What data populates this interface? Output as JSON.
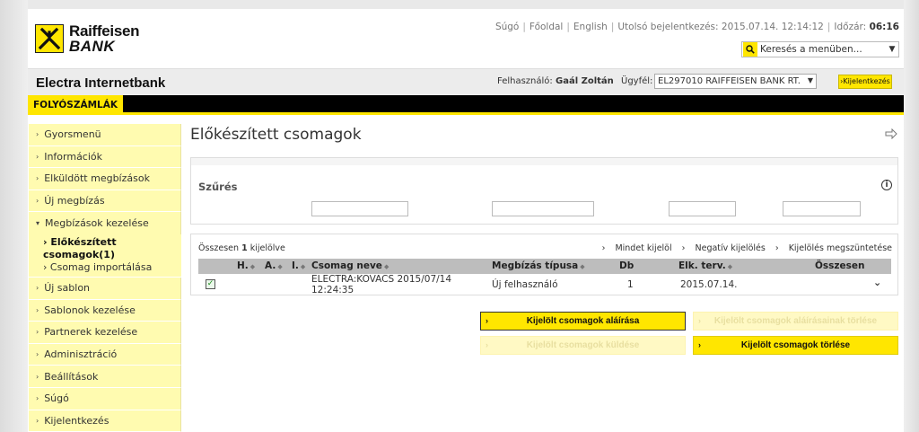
{
  "brand": {
    "line1": "Raiffeisen",
    "line2": "BANK"
  },
  "toplinks": {
    "help": "Súgó",
    "home": "Főoldal",
    "language": "English",
    "last_login_label": "Utolsó bejelentkezés:",
    "last_login_value": "2015.07.14. 12:14:12",
    "timer_label": "Időzár:",
    "timer_value": "06:16"
  },
  "menu_search": {
    "placeholder": "Keresés a menüben..."
  },
  "app": {
    "title": "Electra Internetbank",
    "user_label": "Felhasználó:",
    "user_name": "Gaál Zoltán",
    "client_label": "Ügyfél:",
    "client_value": "EL297010 RAIFFEISEN BANK RT.",
    "logout": "Kijelentkezés"
  },
  "nav": {
    "active_tab": "FOLYÓSZÁMLÁK"
  },
  "sidebar": {
    "items": [
      {
        "label": "Gyorsmenü"
      },
      {
        "label": "Információk"
      },
      {
        "label": "Elküldött megbízások"
      },
      {
        "label": "Új megbízás"
      },
      {
        "label": "Megbízások kezelése"
      }
    ],
    "subitems": [
      {
        "label": "Előkészített csomagok(1)"
      },
      {
        "label": "Csomag importálása"
      }
    ],
    "items2": [
      {
        "label": "Új sablon"
      },
      {
        "label": "Sablonok kezelése"
      },
      {
        "label": "Partnerek kezelése"
      },
      {
        "label": "Adminisztráció"
      },
      {
        "label": "Beállítások"
      },
      {
        "label": "Súgó"
      },
      {
        "label": "Kijelentkezés"
      }
    ]
  },
  "page": {
    "title": "Előkészített csomagok"
  },
  "filter": {
    "label": "Szűrés"
  },
  "results": {
    "count_prefix": "Összesen",
    "count_value": "1",
    "count_suffix": "kijelölve",
    "select_all": "Mindet kijelöl",
    "invert": "Negatív kijelölés",
    "clear": "Kijelölés megszüntetése",
    "columns": [
      "H.",
      "A.",
      "I.",
      "Csomag neve",
      "Megbízás típusa",
      "Db",
      "Elk. terv.",
      "Összesen"
    ],
    "rows": [
      {
        "name_line1": "ELECTRA:KOVACS 2015/07/14",
        "name_line2": "12:24:35",
        "type": "Új felhasználó",
        "count": "1",
        "planned": "2015.07.14."
      }
    ]
  },
  "actions": {
    "sign": "Kijelölt csomagok aláírása",
    "delete_signatures": "Kijelölt csomagok aláírásainak törlése",
    "send": "Kijelölt csomagok küldése",
    "delete": "Kijelölt csomagok törlése"
  }
}
